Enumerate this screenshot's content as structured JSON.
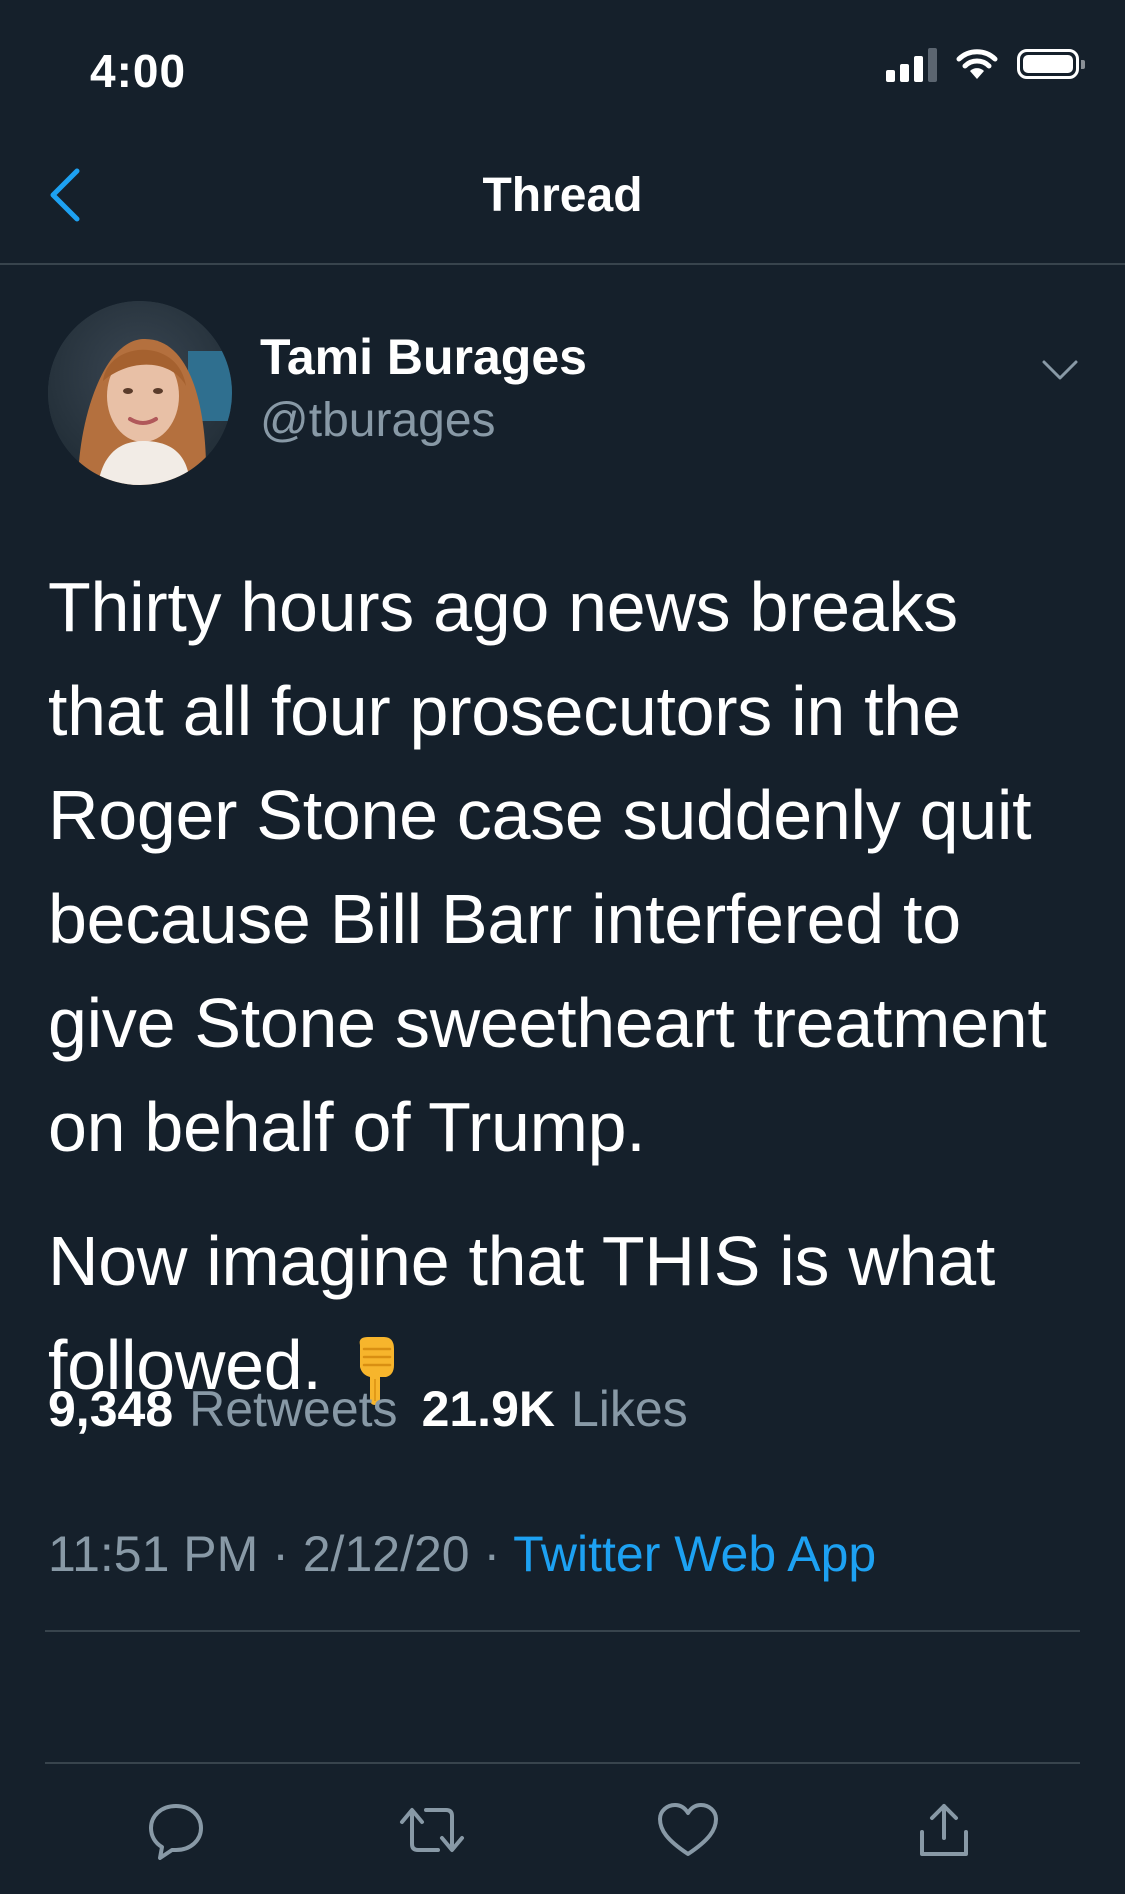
{
  "status_bar": {
    "time": "4:00"
  },
  "nav": {
    "title": "Thread"
  },
  "tweet": {
    "author_name": "Tami Burages",
    "author_handle": "@tburages",
    "paragraph_1": "Thirty hours ago news breaks that all four prosecutors in the Roger Stone case suddenly quit because Bill Barr interfered to give Stone sweetheart treatment on behalf of Trump.",
    "paragraph_2": "Now imagine that THIS is what followed.",
    "time": "11:51 PM",
    "separator": " · ",
    "date": "2/12/20",
    "source": "Twitter Web App",
    "retweets_count": "9,348",
    "retweets_label": "Retweets",
    "likes_count": "21.9K",
    "likes_label": "Likes"
  },
  "icons": {
    "back": "chevron-left-icon",
    "more": "chevron-down-icon",
    "reply": "reply-icon",
    "retweet": "retweet-icon",
    "like": "heart-icon",
    "share": "share-icon",
    "emoji": "backhand-index-pointing-down-emoji"
  },
  "colors": {
    "background": "#15202b",
    "accent": "#1da1f2",
    "secondary_text": "#8899a6",
    "divider": "#38444d"
  }
}
